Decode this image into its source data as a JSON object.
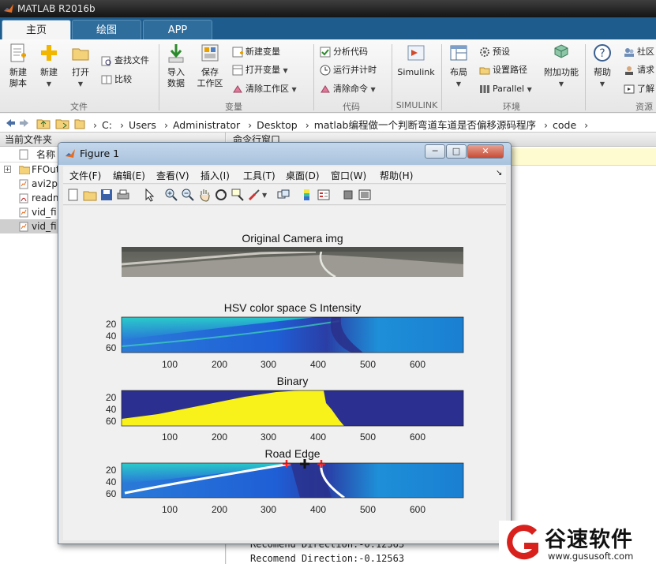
{
  "app": {
    "title": "MATLAB R2016b"
  },
  "tabs": [
    {
      "label": "主页",
      "active": true
    },
    {
      "label": "绘图",
      "active": false
    },
    {
      "label": "APP",
      "active": false
    }
  ],
  "ribbon": {
    "file": {
      "label": "文件",
      "new_script": "新建\n脚本",
      "new": "新建",
      "open": "打开",
      "find_files": "查找文件",
      "compare": "比较"
    },
    "variable": {
      "label": "变量",
      "import": "导入\n数据",
      "save_workspace": "保存\n工作区",
      "new_variable": "新建变量",
      "open_variable": "打开变量",
      "clear_workspace": "清除工作区"
    },
    "code": {
      "label": "代码",
      "analyze": "分析代码",
      "run_time": "运行并计时",
      "clear_commands": "清除命令"
    },
    "simulink": {
      "label": "SIMULINK",
      "button": "Simulink"
    },
    "environment": {
      "label": "环境",
      "layout": "布局",
      "preferences": "预设",
      "set_path": "设置路径",
      "parallel": "Parallel",
      "addons": "附加功能"
    },
    "resources": {
      "label": "资源",
      "help": "帮助",
      "community": "社区",
      "request": "请求",
      "learn": "了解"
    }
  },
  "address": {
    "crumbs": [
      "C:",
      "Users",
      "Administrator",
      "Desktop",
      "matlab编程做一个判断弯道车道是否偏移源码程序",
      "code"
    ]
  },
  "left_panel": {
    "title": "当前文件夹",
    "col_name": "名称",
    "files": [
      {
        "name": "FFOut",
        "type": "folder",
        "selected": false
      },
      {
        "name": "avi2p",
        "type": "mfile",
        "selected": false
      },
      {
        "name": "readm",
        "type": "pdf",
        "selected": false
      },
      {
        "name": "vid_fi",
        "type": "mfile",
        "selected": false
      },
      {
        "name": "vid_fi",
        "type": "mfile",
        "selected": true
      }
    ]
  },
  "cmd_panel": {
    "title": "命令行窗口",
    "output_line_partial": "Recomend Direction:-0.12563",
    "output_line": "Recomend Direction:-0.12563"
  },
  "figure": {
    "title": "Figure 1",
    "menu": [
      "文件(F)",
      "编辑(E)",
      "查看(V)",
      "插入(I)",
      "工具(T)",
      "桌面(D)",
      "窗口(W)",
      "帮助(H)"
    ],
    "subplots": {
      "camera": {
        "title": "Original Camera img"
      },
      "hsv": {
        "title": "HSV color space S Intensity"
      },
      "binary": {
        "title": "Binary"
      },
      "edge": {
        "title": "Road Edge"
      }
    },
    "yticks": [
      "20",
      "40",
      "60"
    ],
    "xticks": [
      "100",
      "200",
      "300",
      "400",
      "500",
      "600"
    ],
    "colors": {
      "parula_dark": "#2b2f8f",
      "parula_yellow": "#f9f11a",
      "edge_line": "#ffffff",
      "marker_red": "#ff0000"
    }
  },
  "watermark": {
    "name": "谷速软件",
    "url": "www.gususoft.com"
  }
}
